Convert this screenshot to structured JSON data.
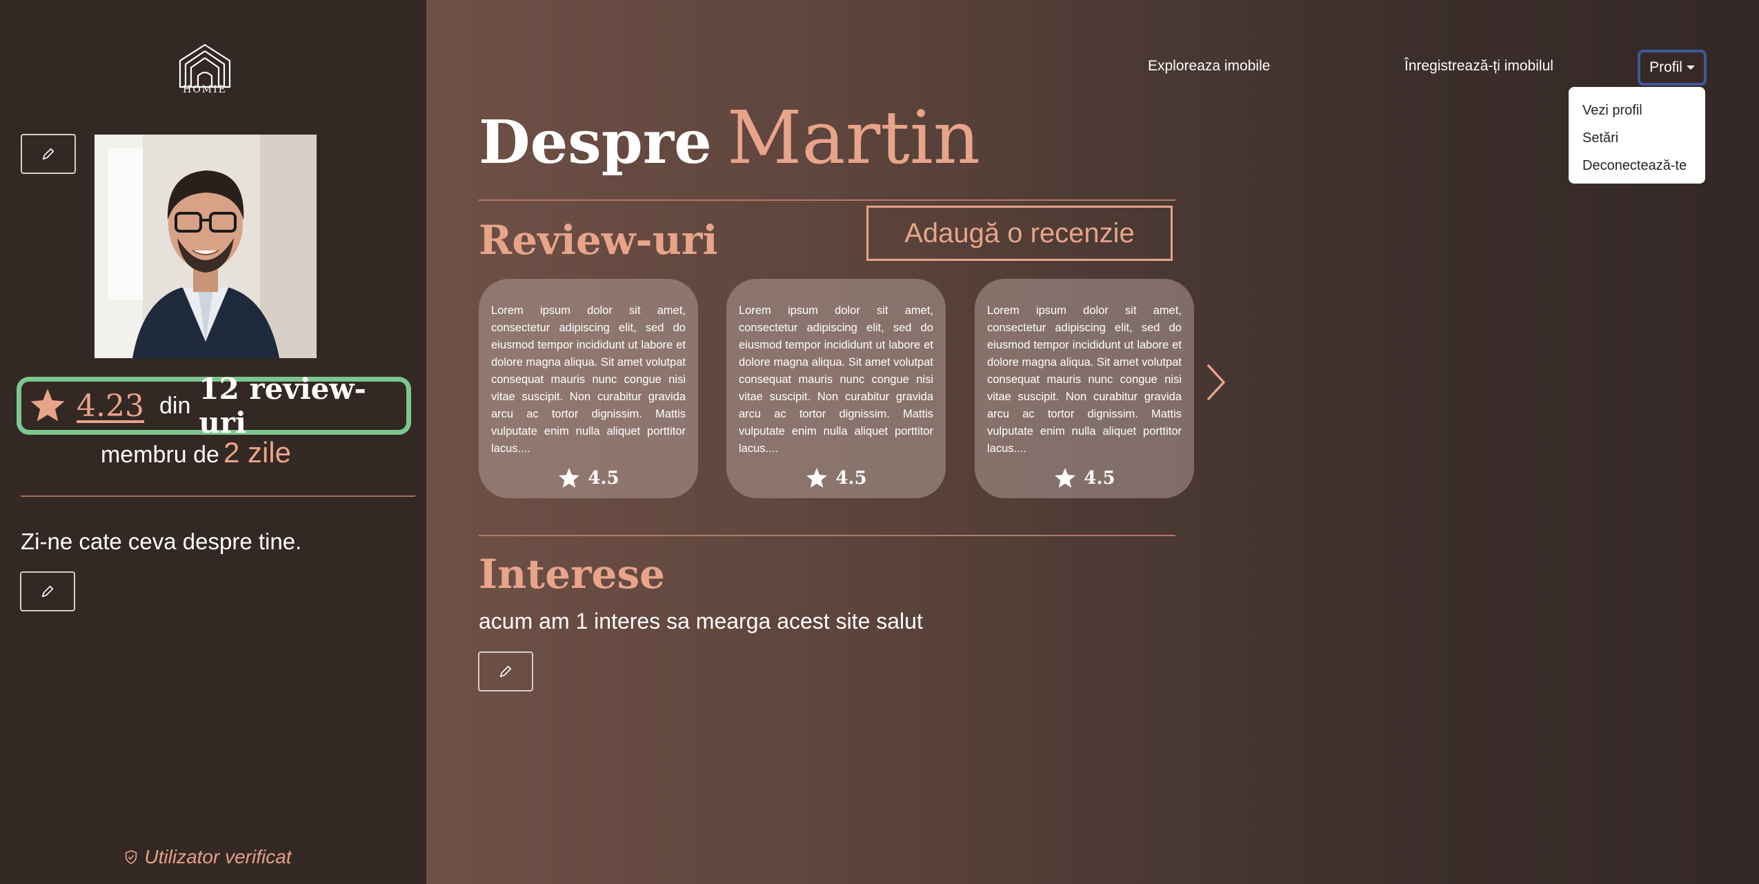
{
  "brand": {
    "logo_text": "HOMIE"
  },
  "nav": {
    "explore": "Exploreaza imobile",
    "register_property": "Înregistrează-ți imobilul",
    "profile": "Profil"
  },
  "profile_menu": {
    "items": [
      {
        "label": "Vezi profil"
      },
      {
        "label": "Setări"
      },
      {
        "label": "Deconectează-te"
      }
    ]
  },
  "sidebar": {
    "rating_value": "4.23",
    "rating_din": "din",
    "rating_count": "12 review-uri",
    "member_prefix": "membru de",
    "member_days": "2 zile",
    "about_placeholder": "Zi-ne cate ceva despre tine.",
    "verified": "Utilizator verificat"
  },
  "main": {
    "title_prefix": "Despre",
    "title_name": "Martin",
    "reviews_title": "Review-uri",
    "add_review": "Adaugă o recenzie",
    "reviews": [
      {
        "text": "Lorem ipsum dolor sit amet, consectetur adipiscing elit, sed do eiusmod tempor incididunt ut labore et dolore magna aliqua. Sit amet volutpat consequat mauris nunc congue nisi vitae suscipit. Non curabitur gravida arcu ac tortor dignissim. Mattis vulputate enim nulla aliquet porttitor lacus....",
        "rating": "4.5"
      },
      {
        "text": "Lorem ipsum dolor sit amet, consectetur adipiscing elit, sed do eiusmod tempor incididunt ut labore et dolore magna aliqua. Sit amet volutpat consequat mauris nunc congue nisi vitae suscipit. Non curabitur gravida arcu ac tortor dignissim. Mattis vulputate enim nulla aliquet porttitor lacus....",
        "rating": "4.5"
      },
      {
        "text": "Lorem ipsum dolor sit amet, consectetur adipiscing elit, sed do eiusmod tempor incididunt ut labore et dolore magna aliqua. Sit amet volutpat consequat mauris nunc congue nisi vitae suscipit. Non curabitur gravida arcu ac tortor dignissim. Mattis vulputate enim nulla aliquet porttitor lacus....",
        "rating": "4.5"
      }
    ],
    "interests_title": "Interese",
    "interests_text": "acum am 1 interes sa mearga acest site salut"
  },
  "icons": {
    "edit": "pencil-icon",
    "star": "star-icon",
    "next": "chevron-right-icon",
    "verified": "shield-check-icon"
  },
  "colors": {
    "accent": "#e8a48a",
    "sidebar_bg": "#342824",
    "rating_border": "#7cc790",
    "profile_border": "#3b5a99"
  }
}
